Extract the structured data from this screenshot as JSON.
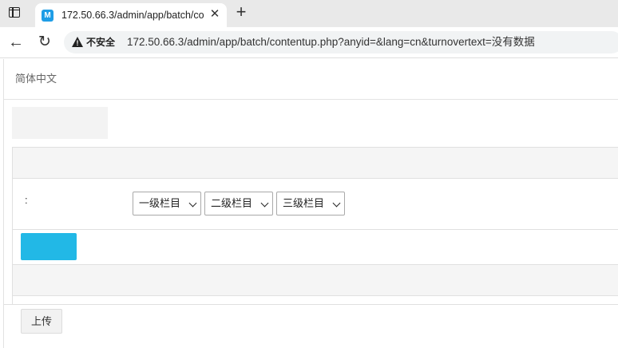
{
  "browser": {
    "tab_title": "172.50.66.3/admin/app/batch/contentup.php",
    "tab_favicon_letter": "M",
    "close_glyph": "✕",
    "new_tab_glyph": "+",
    "back_glyph": "←",
    "reload_glyph": "↻",
    "security_label": "不安全",
    "url": "172.50.66.3/admin/app/batch/contentup.php?anyid=&lang=cn&turnovertext=没有数据"
  },
  "page": {
    "language_label": "简体中文",
    "field_label": ":",
    "selects": [
      {
        "selected": "一级栏目"
      },
      {
        "selected": "二级栏目"
      },
      {
        "selected": "三级栏目"
      }
    ],
    "upload_label": "上传",
    "accent_color": "#22b8e6"
  }
}
